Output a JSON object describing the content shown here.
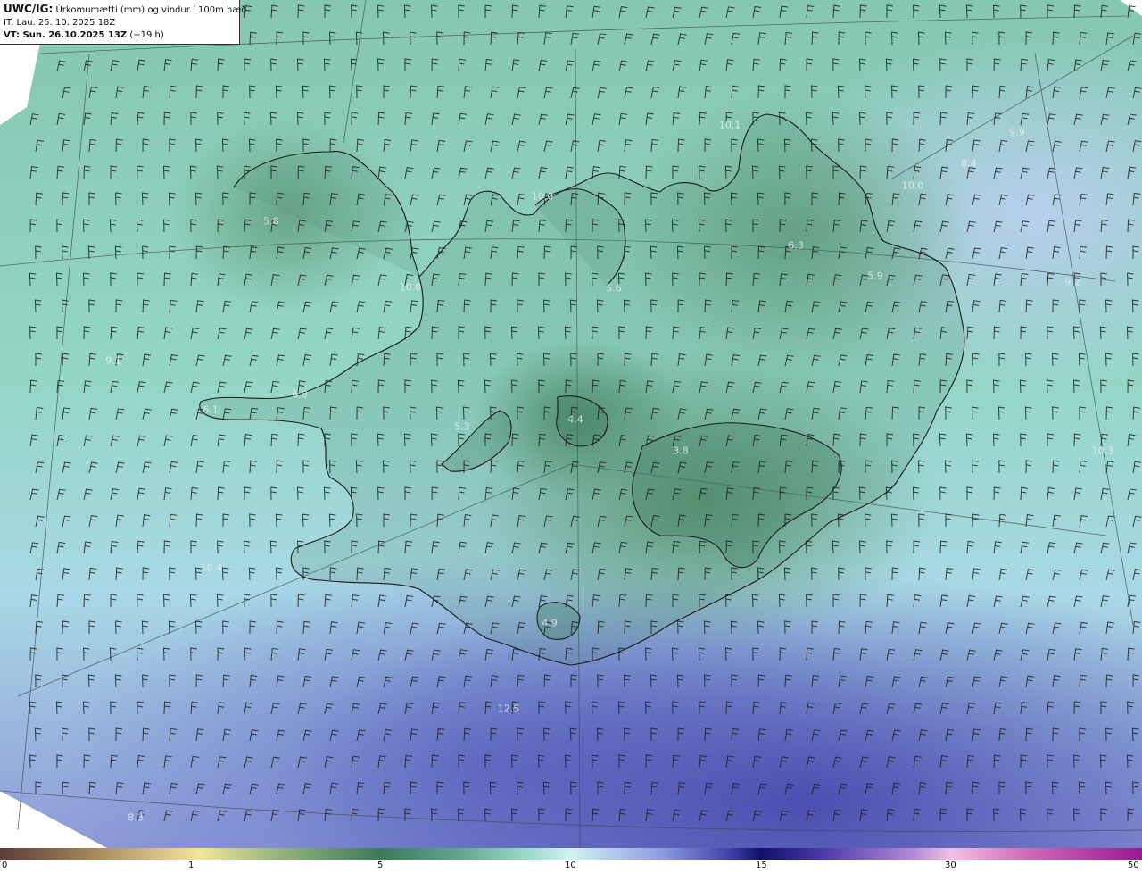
{
  "header": {
    "model": "UWC/IG:",
    "product": "Úrkomumætti (mm) og vindur í 100m hæð",
    "init_time": "IT: Lau. 25. 10. 2025 18Z",
    "valid_prefix": "VT: Sun. 26.10.2025 13Z",
    "lead_time": "(+19 h)"
  },
  "value_labels": [
    "5.8",
    "10.0",
    "10.1",
    "5.6",
    "6.3",
    "5.9",
    "10.0",
    "8.4",
    "9.9",
    "10.0",
    "9.2",
    "6.8",
    "6.1",
    "5.3",
    "4.4",
    "3.8",
    "10.4",
    "4.9",
    "12.5",
    "8.3",
    "9.1",
    "10.3"
  ],
  "colorbar": {
    "ticks": [
      "0",
      "1",
      "5",
      "10",
      "15",
      "30",
      "50"
    ]
  },
  "colors": {
    "land_low": "#5f9a76",
    "sea": "#94d6c6",
    "heavy_precip": "#4a4fb0",
    "coastline": "#1a1a1a"
  }
}
